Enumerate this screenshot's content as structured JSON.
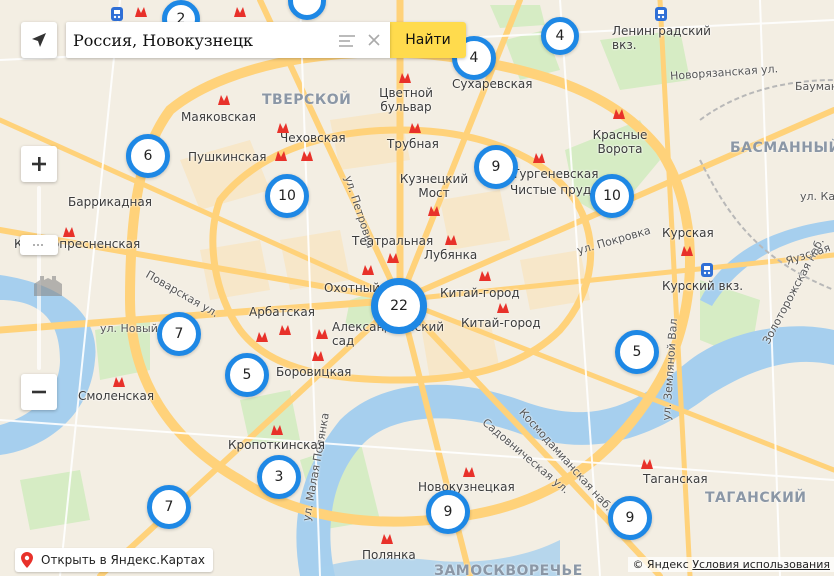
{
  "search": {
    "value": "Россия, Новокузнецк",
    "submit_label": "Найти"
  },
  "districts": [
    {
      "id": "tverskoy",
      "text": "ТВЕРСКОЙ"
    },
    {
      "id": "basmanny",
      "text": "БАСМАННЫЙ"
    },
    {
      "id": "tagansky",
      "text": "ТАГАНСКИЙ"
    },
    {
      "id": "zamoskvorechye",
      "text": "ЗАМОСКВОРЕЧЬЕ"
    }
  ],
  "stations": [
    "Маяковская",
    "Пушкинская",
    "Чеховская",
    "Цветной бульвар",
    "Трубная",
    "Сухаревская",
    "Красные Ворота",
    "Кузнецкий Мост",
    "Тургеневская",
    "Чистые пруды",
    "Баррикадная",
    "Краснопресненская",
    "Театральная",
    "Лубянка",
    "Охотный Ряд",
    "Китай-город",
    "Арбатская",
    "Александровский сад",
    "Боровицкая",
    "Смоленская",
    "Кропоткинская",
    "Полянка",
    "Новокузнецкая",
    "Таганская",
    "Курская",
    "Курский вкз.",
    "Ленинградский вкз."
  ],
  "streets": {
    "petrovka": "ул. Петровка",
    "novoryazanskaya": "Новорязанская ул.",
    "pokrovka": "ул. Покровка",
    "povarskaya": "Поварская ул.",
    "novy_arbat": "ул. Новый Арбат",
    "zemlyanoy_val": "ул. Земляной Вал",
    "sadovnicheskaya": "Садовническая ул.",
    "kosmodamianskaya": "Космодамианская наб.",
    "malaya_polyanka": "ул. Малая Полянка",
    "kazakova": "ул. Казакова",
    "zolotorozhskaya": "Золоторожская наб.",
    "baumanskaya": "Бауманская",
    "yauzskaya": "Яузская"
  },
  "clusters": [
    {
      "id": "c-top-left",
      "count": "2"
    },
    {
      "id": "c-sukharevskaya",
      "count": "4"
    },
    {
      "id": "c-leningradsky",
      "count": "4"
    },
    {
      "id": "c-mayakovskaya",
      "count": "6"
    },
    {
      "id": "c-kuznetsky",
      "count": "9"
    },
    {
      "id": "c-chekhovskaya",
      "count": "10"
    },
    {
      "id": "c-chistye",
      "count": "10"
    },
    {
      "id": "c-center",
      "count": "22"
    },
    {
      "id": "c-arbat",
      "count": "7"
    },
    {
      "id": "c-borovitskaya",
      "count": "5"
    },
    {
      "id": "c-kursk",
      "count": "5"
    },
    {
      "id": "c-kropotkinskaya",
      "count": "3"
    },
    {
      "id": "c-yakimanka",
      "count": "7"
    },
    {
      "id": "c-novokuznetskaya",
      "count": "9"
    },
    {
      "id": "c-taganskaya",
      "count": "9"
    }
  ],
  "open_in_maps": "Открыть в Яндекс.Картах",
  "copyright": {
    "prefix": "© Яндекс",
    "terms": "Условия использования"
  },
  "colors": {
    "cluster": "#1e88e5",
    "metro": "#e8312a",
    "search_button": "#ffdb4d",
    "river": "#a6cfee",
    "road": "#ffd27a"
  },
  "icons": [
    "geolocation-icon",
    "clear-icon",
    "list-icon",
    "zoom-in-icon",
    "zoom-out-icon",
    "metro-icon",
    "map-pin-icon",
    "railway-icon"
  ]
}
